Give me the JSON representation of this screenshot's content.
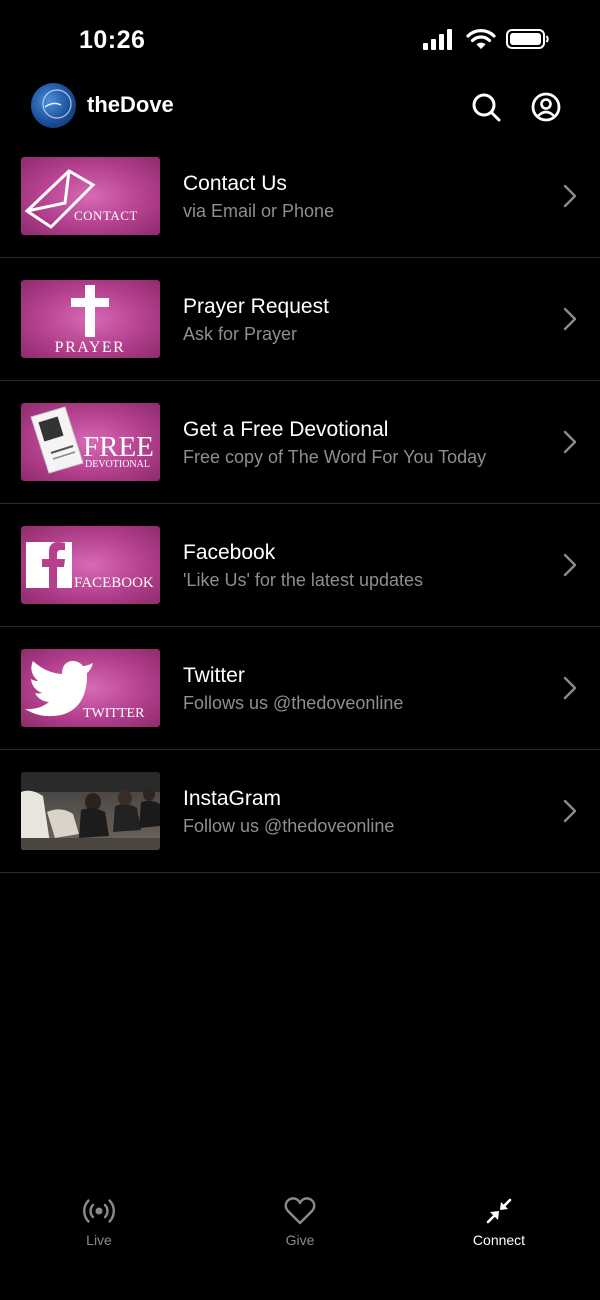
{
  "status_bar": {
    "time": "10:26",
    "icons": [
      "cellular-signal-icon",
      "wifi-icon",
      "battery-icon"
    ]
  },
  "header": {
    "title": "theDove",
    "logo": "thedove-logo",
    "actions": [
      "search-icon",
      "profile-icon"
    ]
  },
  "items": [
    {
      "title": "Contact Us",
      "subtitle": "via Email or Phone",
      "thumb_label": "CONTACT",
      "thumb_icon": "envelope-icon"
    },
    {
      "title": "Prayer Request",
      "subtitle": "Ask for Prayer",
      "thumb_label": "PRAYER",
      "thumb_icon": "cross-icon"
    },
    {
      "title": "Get a Free Devotional",
      "subtitle": "Free copy of The Word For You Today",
      "thumb_label": "FREE",
      "thumb_label_2": "DEVOTIONAL",
      "thumb_icon": "book-icon"
    },
    {
      "title": "Facebook",
      "subtitle": "'Like Us' for the latest updates",
      "thumb_label": "FACEBOOK",
      "thumb_icon": "facebook-icon"
    },
    {
      "title": "Twitter",
      "subtitle": "Follows us @thedoveonline",
      "thumb_label": "TWITTER",
      "thumb_icon": "twitter-bird-icon"
    },
    {
      "title": "InstaGram",
      "subtitle": "Follow us @thedoveonline",
      "thumb_icon": "photo"
    }
  ],
  "tabs": [
    {
      "label": "Live",
      "icon": "broadcast-icon",
      "active": false
    },
    {
      "label": "Give",
      "icon": "heart-icon",
      "active": false
    },
    {
      "label": "Connect",
      "icon": "compress-arrows-icon",
      "active": true
    }
  ],
  "colors": {
    "background": "#000000",
    "thumb_pink": "#b4408e",
    "subtitle_gray": "#8e8e93",
    "tab_inactive": "#8a8a8a",
    "tab_active": "#ffffff",
    "separator": "#2a2a2a"
  }
}
